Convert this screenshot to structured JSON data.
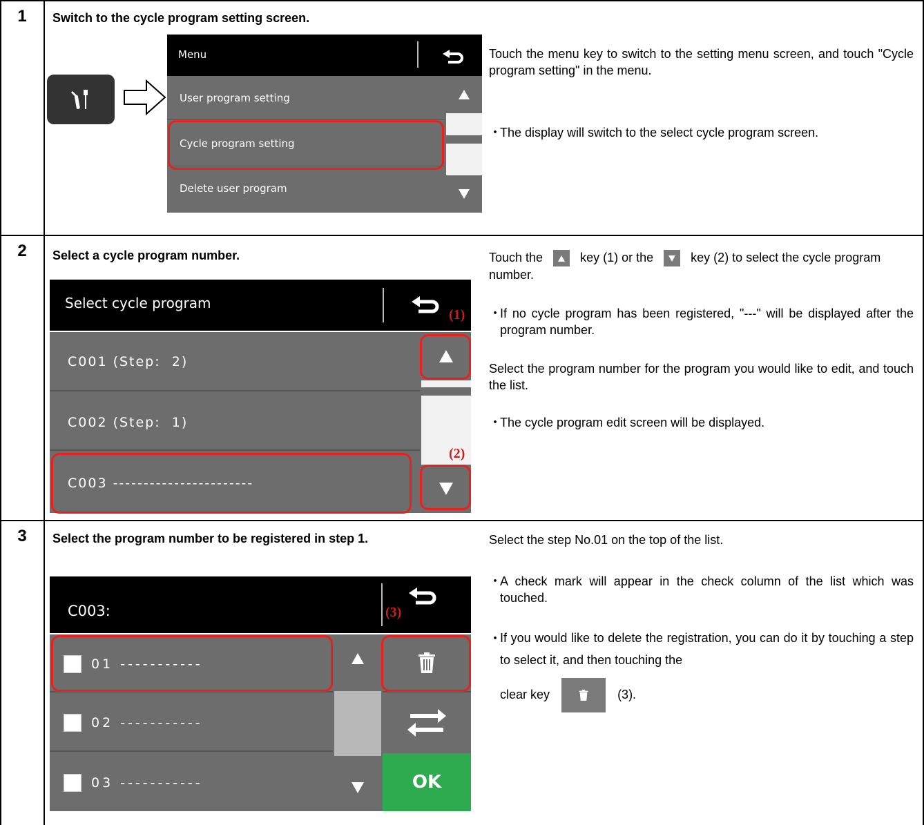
{
  "steps": [
    {
      "number": "1",
      "title": "Switch to the cycle program setting screen.",
      "description": "Touch the menu key to switch to the setting menu screen, and touch \"Cycle program setting\" in the menu.",
      "bullets": [
        "The display will switch to the select cycle program screen."
      ],
      "screen": {
        "title": "Menu",
        "back_icon": "return-arrow-icon",
        "items": [
          "User program setting",
          "Cycle program setting",
          "Delete user program"
        ],
        "menu_key_icon": "tools-icon",
        "arrow_icon": "outline-right-arrow-icon"
      }
    },
    {
      "number": "2",
      "title": "Select a cycle program number.",
      "description_parts": [
        "Touch the",
        "key (1) or the",
        "key (2) to select the cycle program number."
      ],
      "bullet1": "If no cycle program has been registered, \"---\" will be displayed after the program number.",
      "description2": "Select the program number for the program you would like to edit, and touch the list.",
      "bullet2": "The cycle program edit screen will be displayed.",
      "screen": {
        "title": "Select cycle program",
        "items": [
          "C001 (Step:  2)",
          "C002 (Step:  1)",
          "C003 -----------------------"
        ],
        "label_up": "(1)",
        "label_down": "(2)"
      }
    },
    {
      "number": "3",
      "title": "Select the program number to be registered in step 1.",
      "description": "Select the step No.01 on the top of the list.",
      "bullet1": "A check mark will appear in the check column of the list which was touched.",
      "bullet2_parts": [
        "If you would like to delete the registration, you can do it by touching a step to select it, and then touching the",
        "clear key",
        "(3)."
      ],
      "screen": {
        "title": "C003:",
        "rows": [
          "01 -----------",
          "02 -----------",
          "03 -----------"
        ],
        "label_clear": "(3)",
        "ok_label": "OK",
        "ok_color": "#2eaa4f"
      }
    }
  ],
  "bullet_mark": "・",
  "accent_red": "#e8211f"
}
